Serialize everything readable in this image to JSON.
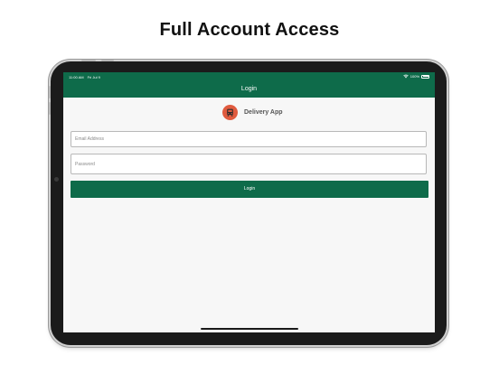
{
  "headline": "Full Account Access",
  "status_bar": {
    "time": "11:00 AM",
    "date": "Fri Jul 9",
    "battery": "100%",
    "icons": [
      "wifi-icon",
      "battery-icon"
    ]
  },
  "nav": {
    "title": "Login"
  },
  "brand": {
    "name": "Delivery App",
    "icon": "delivery-truck-icon"
  },
  "form": {
    "email_placeholder": "Email Address",
    "email_value": "",
    "password_placeholder": "Password",
    "password_value": "",
    "submit_label": "Login"
  },
  "colors": {
    "primary": "#0e6b4a",
    "logo_bg": "#e05b3f",
    "screen_bg": "#f7f7f7"
  }
}
